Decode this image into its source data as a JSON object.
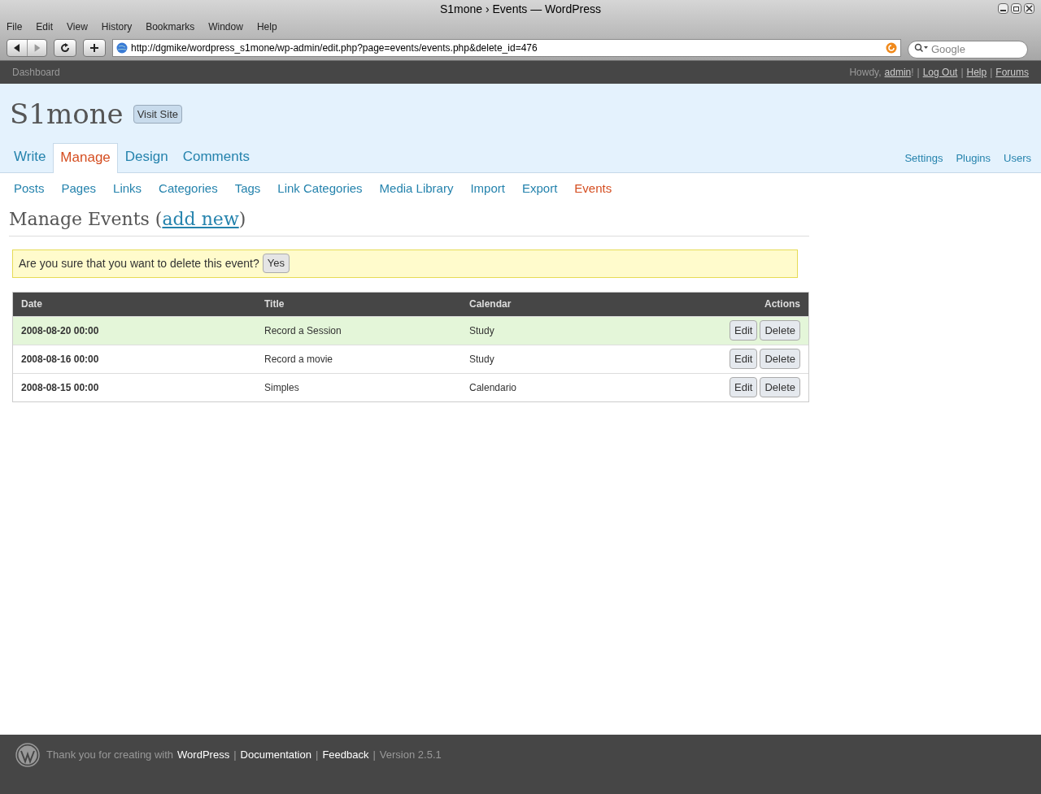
{
  "window": {
    "title": "S1mone › Events — WordPress"
  },
  "menu_bar": [
    "File",
    "Edit",
    "View",
    "History",
    "Bookmarks",
    "Window",
    "Help"
  ],
  "address_bar": {
    "value": "http://dgmike/wordpress_s1mone/wp-admin/edit.php?page=events/events.php&delete_id=476"
  },
  "search": {
    "placeholder": "Google"
  },
  "admin_bar": {
    "dashboard": "Dashboard",
    "greeting": "Howdy,",
    "user": "admin",
    "exclaim": "!",
    "separator": "|",
    "links": [
      "Log Out",
      "Help",
      "Forums"
    ]
  },
  "site": {
    "title": "S1mone",
    "visit_button": "Visit Site"
  },
  "main_tabs": [
    {
      "label": "Write",
      "selected": false
    },
    {
      "label": "Manage",
      "selected": true
    },
    {
      "label": "Design",
      "selected": false
    },
    {
      "label": "Comments",
      "selected": false
    }
  ],
  "right_links": [
    "Settings",
    "Plugins",
    "Users"
  ],
  "sub_tabs": [
    {
      "label": "Posts",
      "selected": false
    },
    {
      "label": "Pages",
      "selected": false
    },
    {
      "label": "Links",
      "selected": false
    },
    {
      "label": "Categories",
      "selected": false
    },
    {
      "label": "Tags",
      "selected": false
    },
    {
      "label": "Link Categories",
      "selected": false
    },
    {
      "label": "Media Library",
      "selected": false
    },
    {
      "label": "Import",
      "selected": false
    },
    {
      "label": "Export",
      "selected": false
    },
    {
      "label": "Events",
      "selected": true
    }
  ],
  "heading": {
    "text": "Manage Events (",
    "link": "add new",
    "close": ")"
  },
  "notice": {
    "text": "Are you sure that you want to delete this event?",
    "button": "Yes"
  },
  "table": {
    "columns": [
      "Date",
      "Title",
      "Calendar",
      "Actions"
    ],
    "rows": [
      {
        "date": "2008-08-20 00:00",
        "title": "Record a Session",
        "calendar": "Study",
        "highlighted": true,
        "actions": [
          "Edit",
          "Delete"
        ]
      },
      {
        "date": "2008-08-16 00:00",
        "title": "Record a movie",
        "calendar": "Study",
        "highlighted": false,
        "actions": [
          "Edit",
          "Delete"
        ]
      },
      {
        "date": "2008-08-15 00:00",
        "title": "Simples",
        "calendar": "Calendario",
        "highlighted": false,
        "actions": [
          "Edit",
          "Delete"
        ]
      }
    ]
  },
  "footer": {
    "text": "Thank you for creating with",
    "separator": "|",
    "links": [
      "WordPress",
      "Documentation",
      "Feedback"
    ],
    "version": "Version 2.5.1"
  }
}
